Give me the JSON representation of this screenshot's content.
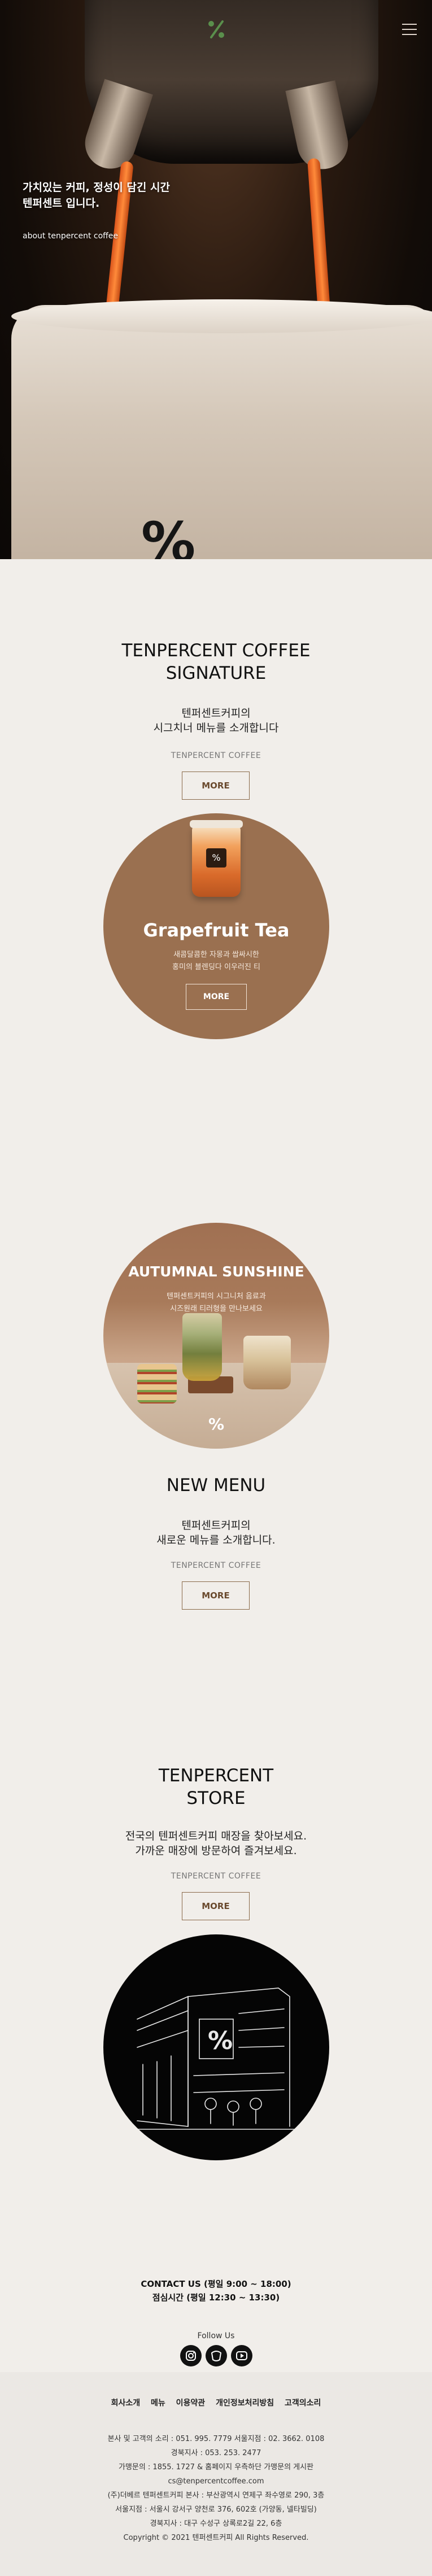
{
  "header": {
    "menu_icon": "hamburger-icon",
    "logo_icon": "tenpercent-logo-icon"
  },
  "hero": {
    "title_line1": "가치있는 커피, 정성이 담긴 시간",
    "title_line2": "텐퍼센트 입니다.",
    "subtitle": "about tenpercent coffee"
  },
  "signature": {
    "title_line1": "TENPERCENT COFFEE",
    "title_line2": "SIGNATURE",
    "desc_line1": "텐퍼센트커피의",
    "desc_line2": "시그치너 메뉴를 소개합니다",
    "brand": "TENPERCENT COFFEE",
    "more_label": "MORE",
    "card": {
      "name": "Grapefruit Tea",
      "desc_line1": "새콤달콤한 자몽과 쌉싸시한",
      "desc_line2": "홍미의 블렌딩다 이우러진 티",
      "more_label": "MORE"
    }
  },
  "new_menu": {
    "card": {
      "title": "AUTUMNAL SUNSHINE",
      "desc_line1": "텐퍼센트커피의 시그니처 음료과",
      "desc_line2": "시즈원래 티러형을 만나보세요"
    },
    "title": "NEW MENU",
    "desc_line1": "텐퍼센트커피의",
    "desc_line2": "새로운 메뉴를 소개합니다.",
    "brand": "TENPERCENT COFFEE",
    "more_label": "MORE"
  },
  "store": {
    "title_line1": "TENPERCENT",
    "title_line2": "STORE",
    "desc_line1": "전국의 텐퍼센트커피 매장을 찾아보세요.",
    "desc_line2": "가까운 매장에 방문하여 즐겨보세요.",
    "brand": "TENPERCENT COFFEE",
    "more_label": "MORE"
  },
  "footer": {
    "contact_line1": "CONTACT US (평일 9:00 ~ 18:00)",
    "contact_line2": "점심시간 (평일 12:30 ~ 13:30)",
    "follow": "Follow Us",
    "social_icons": [
      "instagram-icon",
      "kakao-icon",
      "youtube-icon"
    ],
    "links": [
      "회사소개",
      "메뉴",
      "이용약관",
      "개인정보처리방침",
      "고객의소리"
    ],
    "info": [
      "본사 및 고객의 소리 : 051. 995. 7779 서울지점 : 02. 3662. 0108",
      "경북지사 : 053. 253. 2477",
      "가맹문의 : 1855. 1727 & 홈페이지 우측하단 가맹문의 게시판",
      "cs@tenpercentcoffee.com",
      "(주)더베르 텐퍼센트커피 본사 : 부산광역시 연제구 좌수영로 290, 3층",
      "서울지점 : 서울시 강서구 양천로 376, 602호 (가양동, 넬타빌딩)",
      "경북지사 : 대구 수성구 상록로2길 22, 6층",
      "Copyright © 2021 텐퍼센트커피 All Rights Reserved."
    ]
  }
}
